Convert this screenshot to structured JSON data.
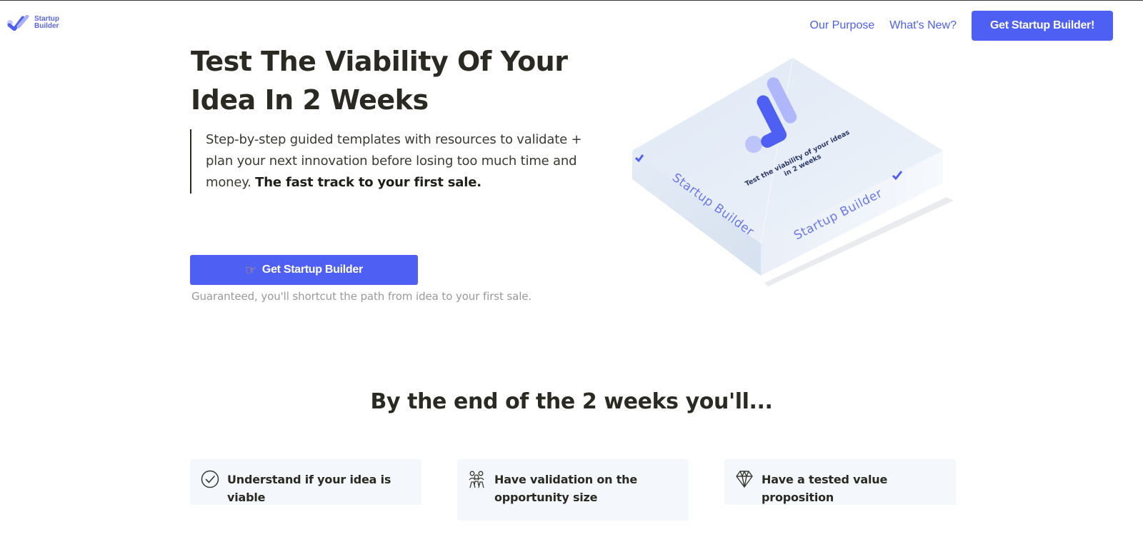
{
  "header": {
    "logo_text": "Startup Builder",
    "nav": [
      {
        "label": "Our Purpose"
      },
      {
        "label": "What's New?"
      }
    ],
    "cta_label": "Get Startup Builder!"
  },
  "hero": {
    "title": "Test The Viability Of Your Idea In 2 Weeks",
    "subtitle": "Step-by-step guided templates with resources to validate + plan your next innovation before losing too much time and money.",
    "subtitle_bold": "The fast track to your first sale.",
    "cta_label": "Get Startup Builder",
    "cta_icon": "pointing-hand-icon",
    "note": "Guaranteed, you'll shortcut the path from idea to your first sale."
  },
  "product_box": {
    "top_text": "Test the viability of your ideas in 2 weeks",
    "side_left_label": "Startup Builder",
    "side_right_label": "Startup Builder"
  },
  "outcomes": {
    "title": "By the end of the 2 weeks you'll...",
    "items": [
      {
        "label": "Understand if your idea is viable",
        "icon": "check-circle-icon"
      },
      {
        "label": "Have validation on the opportunity size",
        "icon": "people-group-icon"
      },
      {
        "label": "Have a tested value proposition",
        "icon": "diamond-icon"
      }
    ]
  },
  "colors": {
    "brand": "#4e5ff4",
    "heading": "#2a2a22",
    "muted": "#9a9a9a",
    "card_bg": "#f4f7fb"
  }
}
